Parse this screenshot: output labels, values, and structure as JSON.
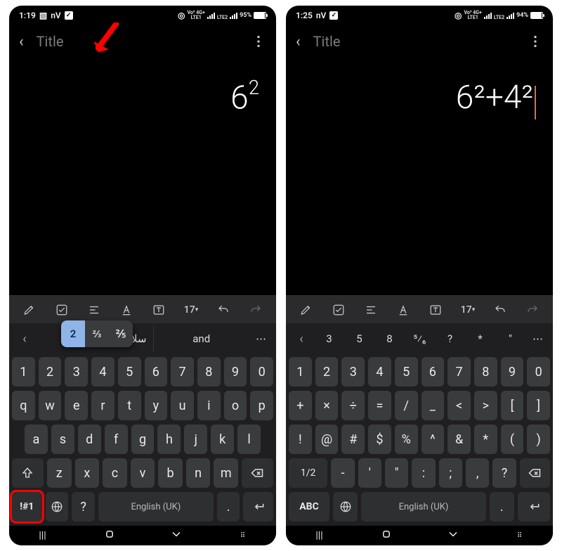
{
  "left": {
    "status": {
      "time": "1:19",
      "label1": "nV",
      "network": "Vo⁵ 4G+",
      "lte": "LTE1 LTE2",
      "battery": "95%"
    },
    "app": {
      "title": "Title"
    },
    "content": {
      "text_base": "6",
      "text_sup": "2"
    },
    "toolbar": {
      "size": "17"
    },
    "popup": {
      "items": [
        "2",
        "⅔",
        "⅖"
      ],
      "selected": 0
    },
    "suggestions": {
      "center1": "سلام",
      "center2": "and"
    },
    "keys": {
      "row1": [
        "1",
        "2",
        "3",
        "4",
        "5",
        "6",
        "7",
        "8",
        "9",
        "0"
      ],
      "row2": [
        "q",
        "w",
        "e",
        "r",
        "t",
        "y",
        "u",
        "i",
        "o",
        "p"
      ],
      "row3": [
        "a",
        "s",
        "d",
        "f",
        "g",
        "h",
        "j",
        "k",
        "l"
      ],
      "row4": [
        "z",
        "x",
        "c",
        "v",
        "b",
        "n",
        "m"
      ],
      "mode": "!#1",
      "space": "English (UK)",
      "qmark": "?",
      "dot": "."
    }
  },
  "right": {
    "status": {
      "time": "1:25",
      "label1": "nV",
      "network": "Vo⁵ 4G+",
      "lte": "LTE1 LTE2",
      "battery": "94%"
    },
    "app": {
      "title": "Title"
    },
    "content": {
      "full": "6²+4²"
    },
    "toolbar": {
      "size": "17"
    },
    "suggestions": {
      "row": [
        "3",
        "5",
        "8",
        "⁵⁄₆",
        "?",
        "*",
        "\""
      ]
    },
    "keys": {
      "row1": [
        "1",
        "2",
        "3",
        "4",
        "5",
        "6",
        "7",
        "8",
        "9",
        "0"
      ],
      "row2": [
        "+",
        "×",
        "÷",
        "=",
        "/",
        "_",
        "<",
        ">",
        "[",
        "]"
      ],
      "row3": [
        "!",
        "@",
        "#",
        "$",
        "%",
        "^",
        "&",
        "*",
        "(",
        ")"
      ],
      "row4": [
        "-",
        "'",
        "\"",
        ":",
        ";",
        ",",
        "?"
      ],
      "half": "1/2",
      "mode": "ABC",
      "space": "English (UK)",
      "dot": "."
    }
  },
  "icons": {
    "book": "book-icon",
    "attach": "attach-icon",
    "more": "more-icon",
    "pen": "pen-icon",
    "check": "check-icon",
    "align": "align-icon",
    "text_style": "text-style-icon",
    "box_t": "text-box-icon",
    "undo": "undo-icon",
    "redo": "redo-icon",
    "globe": "globe-icon"
  }
}
